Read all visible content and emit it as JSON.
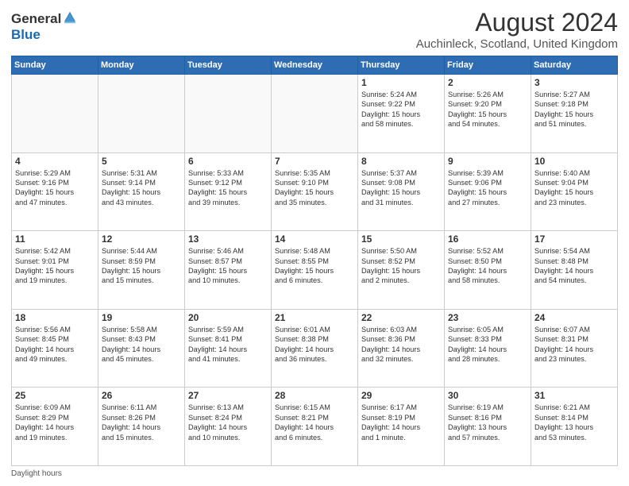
{
  "header": {
    "logo_general": "General",
    "logo_blue": "Blue",
    "title": "August 2024",
    "subtitle": "Auchinleck, Scotland, United Kingdom"
  },
  "days_of_week": [
    "Sunday",
    "Monday",
    "Tuesday",
    "Wednesday",
    "Thursday",
    "Friday",
    "Saturday"
  ],
  "weeks": [
    [
      {
        "day": "",
        "info": ""
      },
      {
        "day": "",
        "info": ""
      },
      {
        "day": "",
        "info": ""
      },
      {
        "day": "",
        "info": ""
      },
      {
        "day": "1",
        "info": "Sunrise: 5:24 AM\nSunset: 9:22 PM\nDaylight: 15 hours\nand 58 minutes."
      },
      {
        "day": "2",
        "info": "Sunrise: 5:26 AM\nSunset: 9:20 PM\nDaylight: 15 hours\nand 54 minutes."
      },
      {
        "day": "3",
        "info": "Sunrise: 5:27 AM\nSunset: 9:18 PM\nDaylight: 15 hours\nand 51 minutes."
      }
    ],
    [
      {
        "day": "4",
        "info": "Sunrise: 5:29 AM\nSunset: 9:16 PM\nDaylight: 15 hours\nand 47 minutes."
      },
      {
        "day": "5",
        "info": "Sunrise: 5:31 AM\nSunset: 9:14 PM\nDaylight: 15 hours\nand 43 minutes."
      },
      {
        "day": "6",
        "info": "Sunrise: 5:33 AM\nSunset: 9:12 PM\nDaylight: 15 hours\nand 39 minutes."
      },
      {
        "day": "7",
        "info": "Sunrise: 5:35 AM\nSunset: 9:10 PM\nDaylight: 15 hours\nand 35 minutes."
      },
      {
        "day": "8",
        "info": "Sunrise: 5:37 AM\nSunset: 9:08 PM\nDaylight: 15 hours\nand 31 minutes."
      },
      {
        "day": "9",
        "info": "Sunrise: 5:39 AM\nSunset: 9:06 PM\nDaylight: 15 hours\nand 27 minutes."
      },
      {
        "day": "10",
        "info": "Sunrise: 5:40 AM\nSunset: 9:04 PM\nDaylight: 15 hours\nand 23 minutes."
      }
    ],
    [
      {
        "day": "11",
        "info": "Sunrise: 5:42 AM\nSunset: 9:01 PM\nDaylight: 15 hours\nand 19 minutes."
      },
      {
        "day": "12",
        "info": "Sunrise: 5:44 AM\nSunset: 8:59 PM\nDaylight: 15 hours\nand 15 minutes."
      },
      {
        "day": "13",
        "info": "Sunrise: 5:46 AM\nSunset: 8:57 PM\nDaylight: 15 hours\nand 10 minutes."
      },
      {
        "day": "14",
        "info": "Sunrise: 5:48 AM\nSunset: 8:55 PM\nDaylight: 15 hours\nand 6 minutes."
      },
      {
        "day": "15",
        "info": "Sunrise: 5:50 AM\nSunset: 8:52 PM\nDaylight: 15 hours\nand 2 minutes."
      },
      {
        "day": "16",
        "info": "Sunrise: 5:52 AM\nSunset: 8:50 PM\nDaylight: 14 hours\nand 58 minutes."
      },
      {
        "day": "17",
        "info": "Sunrise: 5:54 AM\nSunset: 8:48 PM\nDaylight: 14 hours\nand 54 minutes."
      }
    ],
    [
      {
        "day": "18",
        "info": "Sunrise: 5:56 AM\nSunset: 8:45 PM\nDaylight: 14 hours\nand 49 minutes."
      },
      {
        "day": "19",
        "info": "Sunrise: 5:58 AM\nSunset: 8:43 PM\nDaylight: 14 hours\nand 45 minutes."
      },
      {
        "day": "20",
        "info": "Sunrise: 5:59 AM\nSunset: 8:41 PM\nDaylight: 14 hours\nand 41 minutes."
      },
      {
        "day": "21",
        "info": "Sunrise: 6:01 AM\nSunset: 8:38 PM\nDaylight: 14 hours\nand 36 minutes."
      },
      {
        "day": "22",
        "info": "Sunrise: 6:03 AM\nSunset: 8:36 PM\nDaylight: 14 hours\nand 32 minutes."
      },
      {
        "day": "23",
        "info": "Sunrise: 6:05 AM\nSunset: 8:33 PM\nDaylight: 14 hours\nand 28 minutes."
      },
      {
        "day": "24",
        "info": "Sunrise: 6:07 AM\nSunset: 8:31 PM\nDaylight: 14 hours\nand 23 minutes."
      }
    ],
    [
      {
        "day": "25",
        "info": "Sunrise: 6:09 AM\nSunset: 8:29 PM\nDaylight: 14 hours\nand 19 minutes."
      },
      {
        "day": "26",
        "info": "Sunrise: 6:11 AM\nSunset: 8:26 PM\nDaylight: 14 hours\nand 15 minutes."
      },
      {
        "day": "27",
        "info": "Sunrise: 6:13 AM\nSunset: 8:24 PM\nDaylight: 14 hours\nand 10 minutes."
      },
      {
        "day": "28",
        "info": "Sunrise: 6:15 AM\nSunset: 8:21 PM\nDaylight: 14 hours\nand 6 minutes."
      },
      {
        "day": "29",
        "info": "Sunrise: 6:17 AM\nSunset: 8:19 PM\nDaylight: 14 hours\nand 1 minute."
      },
      {
        "day": "30",
        "info": "Sunrise: 6:19 AM\nSunset: 8:16 PM\nDaylight: 13 hours\nand 57 minutes."
      },
      {
        "day": "31",
        "info": "Sunrise: 6:21 AM\nSunset: 8:14 PM\nDaylight: 13 hours\nand 53 minutes."
      }
    ]
  ],
  "footer": {
    "note": "Daylight hours"
  }
}
